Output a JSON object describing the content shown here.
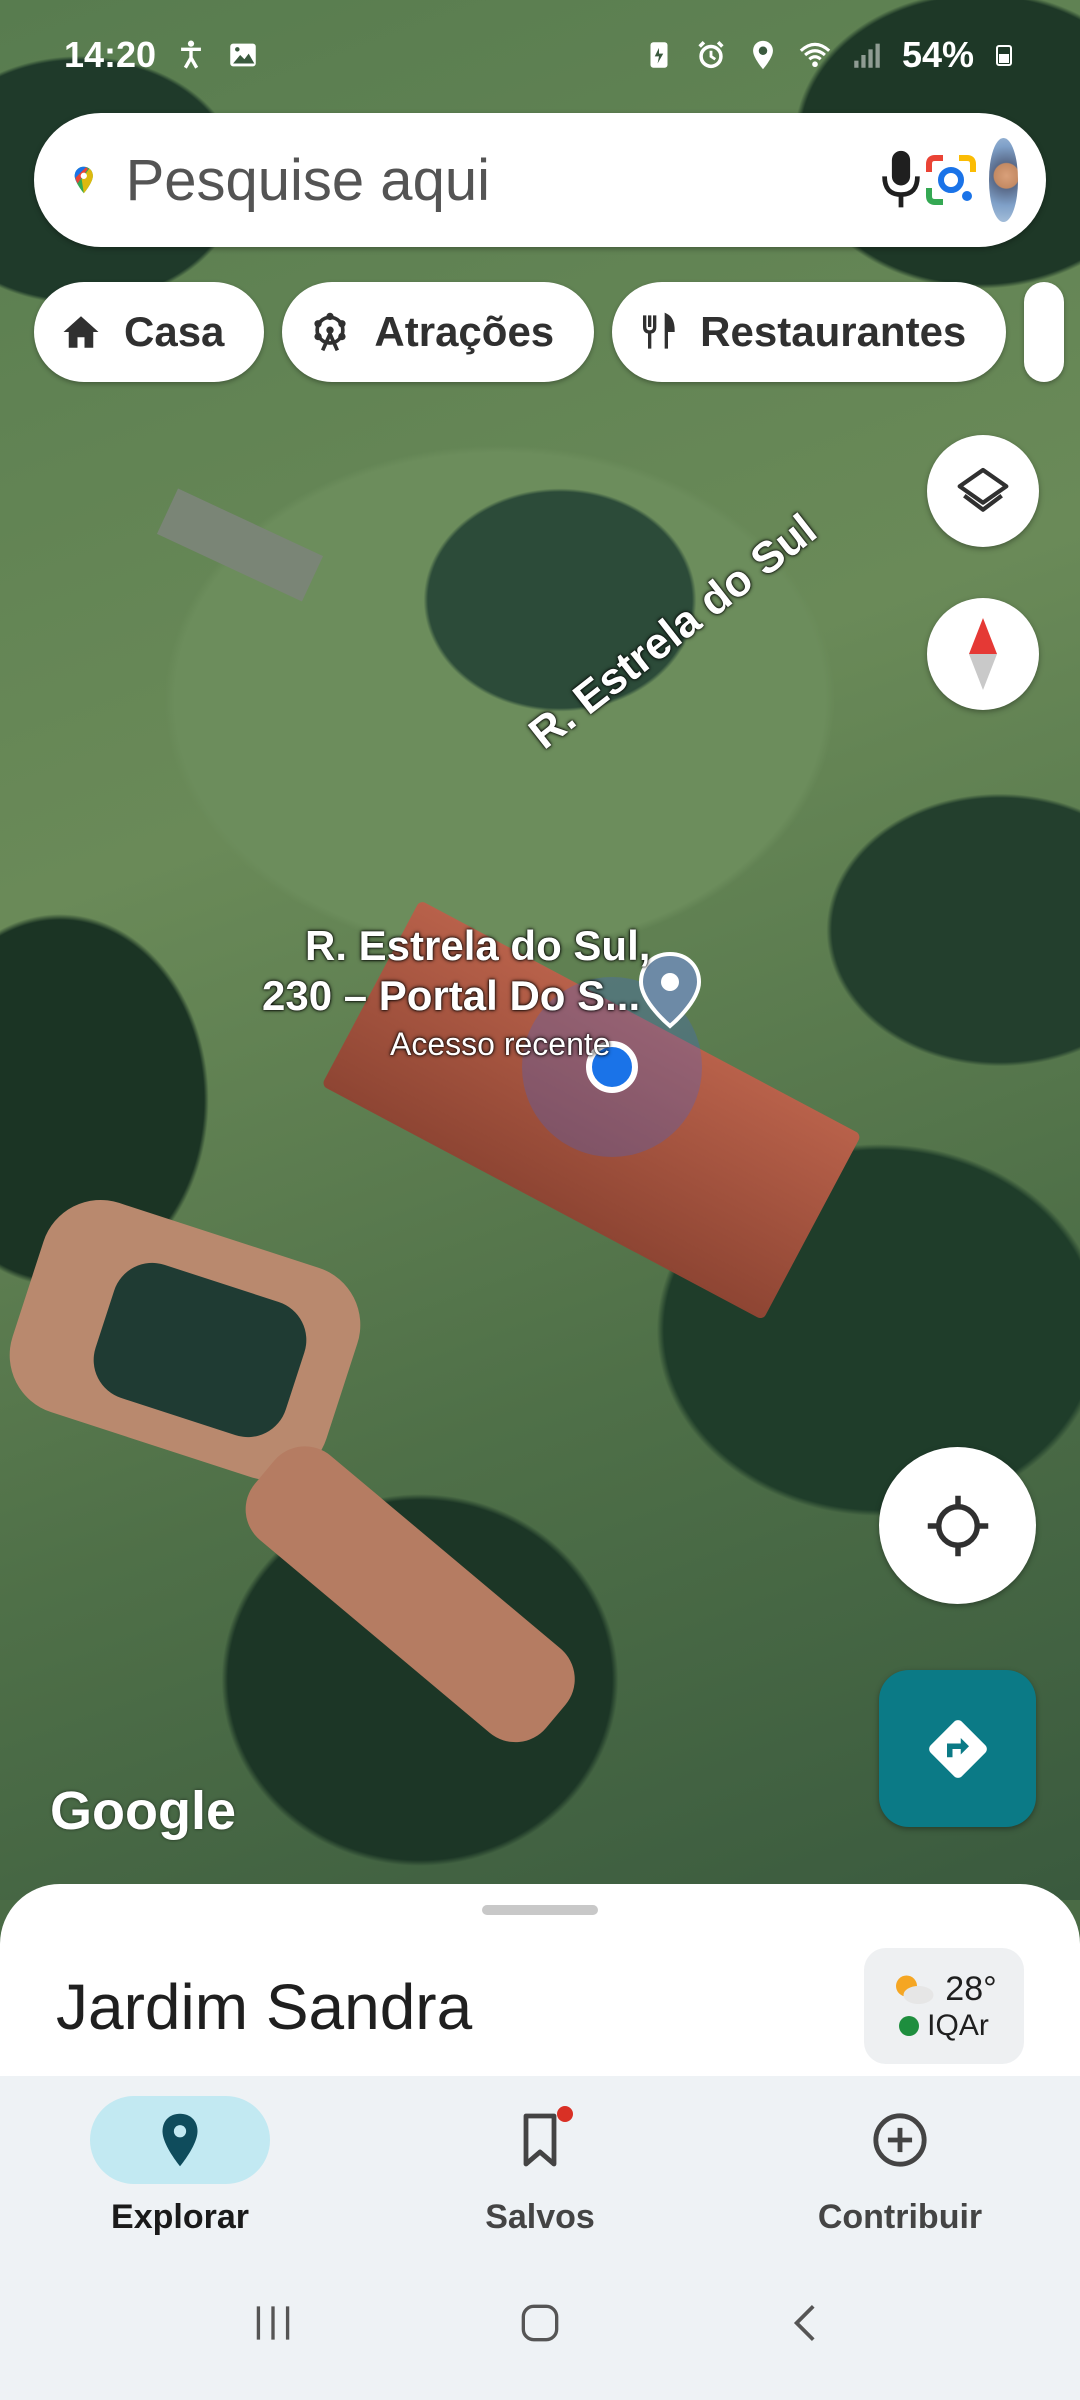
{
  "status_bar": {
    "time": "14:20",
    "battery": "54%"
  },
  "search": {
    "placeholder": "Pesquise aqui"
  },
  "chips": [
    {
      "label": "Casa",
      "icon": "home-icon"
    },
    {
      "label": "Atrações",
      "icon": "ferris-wheel-icon"
    },
    {
      "label": "Restaurantes",
      "icon": "restaurant-icon"
    }
  ],
  "map": {
    "street_name": "R. Estrela do Sul",
    "place_line1": "R. Estrela do Sul,",
    "place_line2": "230 – Portal Do S...",
    "place_sub": "Acesso recente",
    "attribution": "Google"
  },
  "sheet": {
    "title": "Jardim Sandra",
    "temperature": "28°",
    "air_quality": "IQAr"
  },
  "nav": {
    "items": [
      {
        "label": "Explorar",
        "icon": "explore-pin-icon",
        "active": true
      },
      {
        "label": "Salvos",
        "icon": "bookmark-icon",
        "active": false
      },
      {
        "label": "Contribuir",
        "icon": "add-circle-icon",
        "active": false
      }
    ]
  },
  "colors": {
    "accent": "#0b7a86",
    "active_pill": "#c2e9f2",
    "location_dot": "#1a73e8"
  }
}
